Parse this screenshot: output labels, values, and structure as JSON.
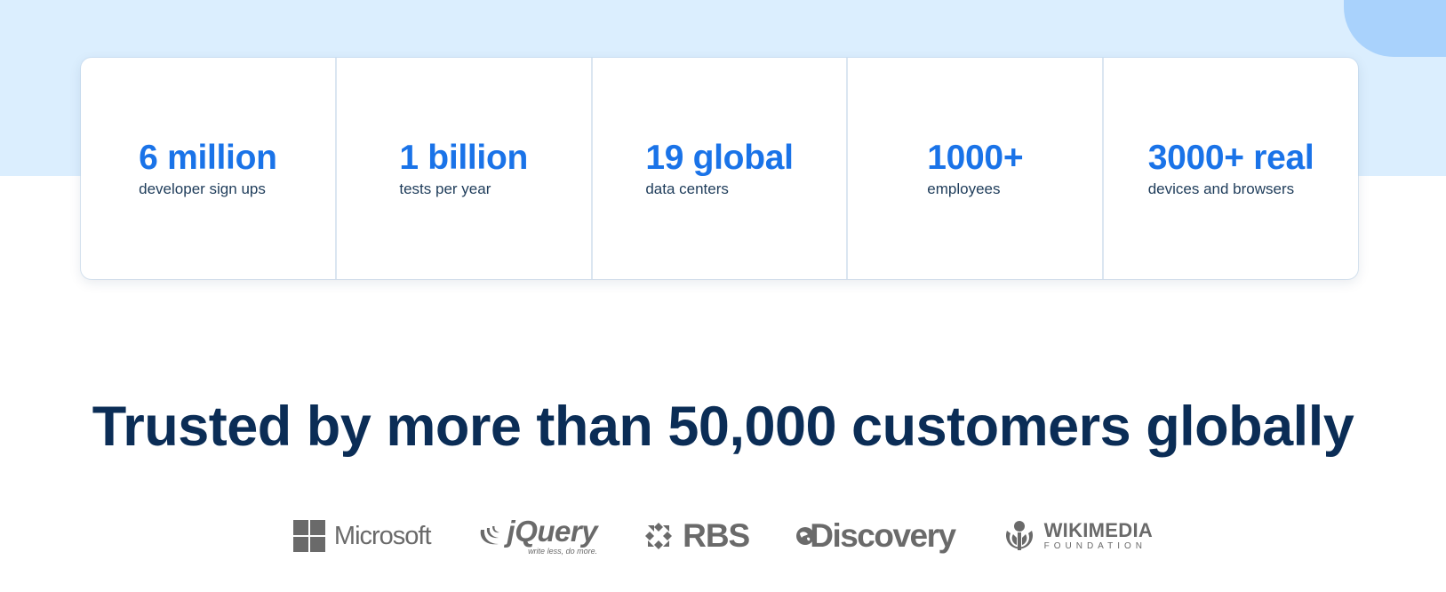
{
  "stats": [
    {
      "value": "6 million",
      "label": "developer sign ups"
    },
    {
      "value": "1 billion",
      "label": "tests per year"
    },
    {
      "value": "19 global",
      "label": "data centers"
    },
    {
      "value": "1000+",
      "label": "employees"
    },
    {
      "value": "3000+ real",
      "label": "devices and browsers"
    }
  ],
  "trusted": {
    "heading": "Trusted by more than 50,000 customers globally"
  },
  "logos": {
    "microsoft": {
      "name": "Microsoft",
      "icon": "microsoft-grid-icon"
    },
    "jquery": {
      "name": "jQuery",
      "tagline": "write less, do more.",
      "icon": "jquery-swoosh-icon"
    },
    "rbs": {
      "name": "RBS",
      "icon": "rbs-daisy-icon"
    },
    "discovery": {
      "name": "Discovery",
      "icon": "discovery-globe-icon"
    },
    "wikimedia": {
      "name": "WIKIMEDIA",
      "subtitle": "FOUNDATION",
      "icon": "wikimedia-icon"
    }
  },
  "colors": {
    "accent": "#1a73e8",
    "heading": "#0b2d56",
    "hero_band": "#dbeefe",
    "logo_gray": "#6a6a6a"
  }
}
